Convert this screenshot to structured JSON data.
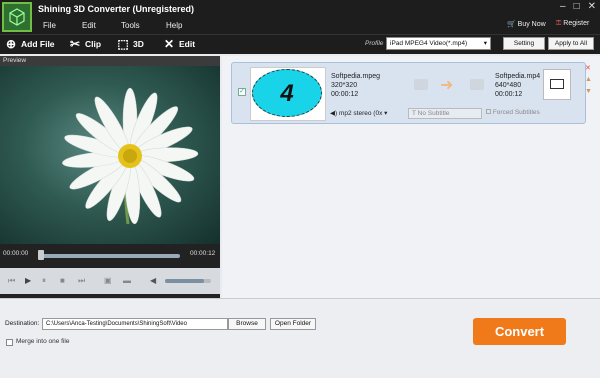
{
  "window": {
    "title": "Shining 3D Converter (Unregistered)"
  },
  "menu": {
    "file": "File",
    "edit": "Edit",
    "tools": "Tools",
    "help": "Help"
  },
  "top_right": {
    "buy_now": "Buy Now",
    "register": "Register"
  },
  "toolbar": {
    "add_file": "Add File",
    "clip": "Clip",
    "threed": "3D",
    "edit": "Edit",
    "profile_label": "Profile",
    "profile_value": "iPad MPEG4 Video(*.mp4)",
    "setting": "Setting",
    "apply_all": "Apply to All"
  },
  "preview": {
    "header": "Preview",
    "time_start": "00:00:00",
    "time_end": "00:00:12",
    "progress": 0.0,
    "volume": 0.85
  },
  "file": {
    "thumb_text": "4",
    "src_name": "Softpedia.mpeg",
    "src_res": "320*320",
    "src_duration": "00:00:12",
    "dst_name": "Softpedia.mp4",
    "dst_res": "640*480",
    "dst_duration": "00:00:12",
    "audio": "mp2 stereo (0x",
    "subtitle": "No Subtitle",
    "forced": "Forced Subtitles"
  },
  "bottom": {
    "dest_label": "Destination:",
    "dest_value": "C:\\Users\\Anca-Testing\\Documents\\ShiningSoft\\Video",
    "browse": "Browse",
    "open_folder": "Open Folder",
    "merge": "Merge into one file",
    "convert": "Convert"
  }
}
